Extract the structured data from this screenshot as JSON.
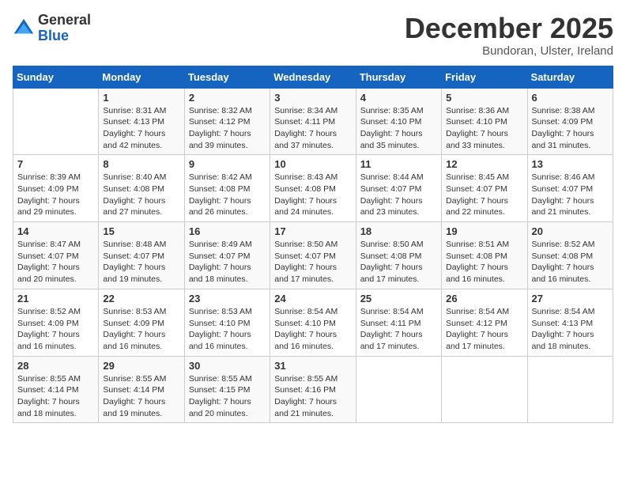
{
  "logo": {
    "general": "General",
    "blue": "Blue"
  },
  "header": {
    "month": "December 2025",
    "location": "Bundoran, Ulster, Ireland"
  },
  "days_of_week": [
    "Sunday",
    "Monday",
    "Tuesday",
    "Wednesday",
    "Thursday",
    "Friday",
    "Saturday"
  ],
  "weeks": [
    [
      {
        "day": "",
        "info": ""
      },
      {
        "day": "1",
        "info": "Sunrise: 8:31 AM\nSunset: 4:13 PM\nDaylight: 7 hours\nand 42 minutes."
      },
      {
        "day": "2",
        "info": "Sunrise: 8:32 AM\nSunset: 4:12 PM\nDaylight: 7 hours\nand 39 minutes."
      },
      {
        "day": "3",
        "info": "Sunrise: 8:34 AM\nSunset: 4:11 PM\nDaylight: 7 hours\nand 37 minutes."
      },
      {
        "day": "4",
        "info": "Sunrise: 8:35 AM\nSunset: 4:10 PM\nDaylight: 7 hours\nand 35 minutes."
      },
      {
        "day": "5",
        "info": "Sunrise: 8:36 AM\nSunset: 4:10 PM\nDaylight: 7 hours\nand 33 minutes."
      },
      {
        "day": "6",
        "info": "Sunrise: 8:38 AM\nSunset: 4:09 PM\nDaylight: 7 hours\nand 31 minutes."
      }
    ],
    [
      {
        "day": "7",
        "info": "Sunrise: 8:39 AM\nSunset: 4:09 PM\nDaylight: 7 hours\nand 29 minutes."
      },
      {
        "day": "8",
        "info": "Sunrise: 8:40 AM\nSunset: 4:08 PM\nDaylight: 7 hours\nand 27 minutes."
      },
      {
        "day": "9",
        "info": "Sunrise: 8:42 AM\nSunset: 4:08 PM\nDaylight: 7 hours\nand 26 minutes."
      },
      {
        "day": "10",
        "info": "Sunrise: 8:43 AM\nSunset: 4:08 PM\nDaylight: 7 hours\nand 24 minutes."
      },
      {
        "day": "11",
        "info": "Sunrise: 8:44 AM\nSunset: 4:07 PM\nDaylight: 7 hours\nand 23 minutes."
      },
      {
        "day": "12",
        "info": "Sunrise: 8:45 AM\nSunset: 4:07 PM\nDaylight: 7 hours\nand 22 minutes."
      },
      {
        "day": "13",
        "info": "Sunrise: 8:46 AM\nSunset: 4:07 PM\nDaylight: 7 hours\nand 21 minutes."
      }
    ],
    [
      {
        "day": "14",
        "info": "Sunrise: 8:47 AM\nSunset: 4:07 PM\nDaylight: 7 hours\nand 20 minutes."
      },
      {
        "day": "15",
        "info": "Sunrise: 8:48 AM\nSunset: 4:07 PM\nDaylight: 7 hours\nand 19 minutes."
      },
      {
        "day": "16",
        "info": "Sunrise: 8:49 AM\nSunset: 4:07 PM\nDaylight: 7 hours\nand 18 minutes."
      },
      {
        "day": "17",
        "info": "Sunrise: 8:50 AM\nSunset: 4:07 PM\nDaylight: 7 hours\nand 17 minutes."
      },
      {
        "day": "18",
        "info": "Sunrise: 8:50 AM\nSunset: 4:08 PM\nDaylight: 7 hours\nand 17 minutes."
      },
      {
        "day": "19",
        "info": "Sunrise: 8:51 AM\nSunset: 4:08 PM\nDaylight: 7 hours\nand 16 minutes."
      },
      {
        "day": "20",
        "info": "Sunrise: 8:52 AM\nSunset: 4:08 PM\nDaylight: 7 hours\nand 16 minutes."
      }
    ],
    [
      {
        "day": "21",
        "info": "Sunrise: 8:52 AM\nSunset: 4:09 PM\nDaylight: 7 hours\nand 16 minutes."
      },
      {
        "day": "22",
        "info": "Sunrise: 8:53 AM\nSunset: 4:09 PM\nDaylight: 7 hours\nand 16 minutes."
      },
      {
        "day": "23",
        "info": "Sunrise: 8:53 AM\nSunset: 4:10 PM\nDaylight: 7 hours\nand 16 minutes."
      },
      {
        "day": "24",
        "info": "Sunrise: 8:54 AM\nSunset: 4:10 PM\nDaylight: 7 hours\nand 16 minutes."
      },
      {
        "day": "25",
        "info": "Sunrise: 8:54 AM\nSunset: 4:11 PM\nDaylight: 7 hours\nand 17 minutes."
      },
      {
        "day": "26",
        "info": "Sunrise: 8:54 AM\nSunset: 4:12 PM\nDaylight: 7 hours\nand 17 minutes."
      },
      {
        "day": "27",
        "info": "Sunrise: 8:54 AM\nSunset: 4:13 PM\nDaylight: 7 hours\nand 18 minutes."
      }
    ],
    [
      {
        "day": "28",
        "info": "Sunrise: 8:55 AM\nSunset: 4:14 PM\nDaylight: 7 hours\nand 18 minutes."
      },
      {
        "day": "29",
        "info": "Sunrise: 8:55 AM\nSunset: 4:14 PM\nDaylight: 7 hours\nand 19 minutes."
      },
      {
        "day": "30",
        "info": "Sunrise: 8:55 AM\nSunset: 4:15 PM\nDaylight: 7 hours\nand 20 minutes."
      },
      {
        "day": "31",
        "info": "Sunrise: 8:55 AM\nSunset: 4:16 PM\nDaylight: 7 hours\nand 21 minutes."
      },
      {
        "day": "",
        "info": ""
      },
      {
        "day": "",
        "info": ""
      },
      {
        "day": "",
        "info": ""
      }
    ]
  ]
}
